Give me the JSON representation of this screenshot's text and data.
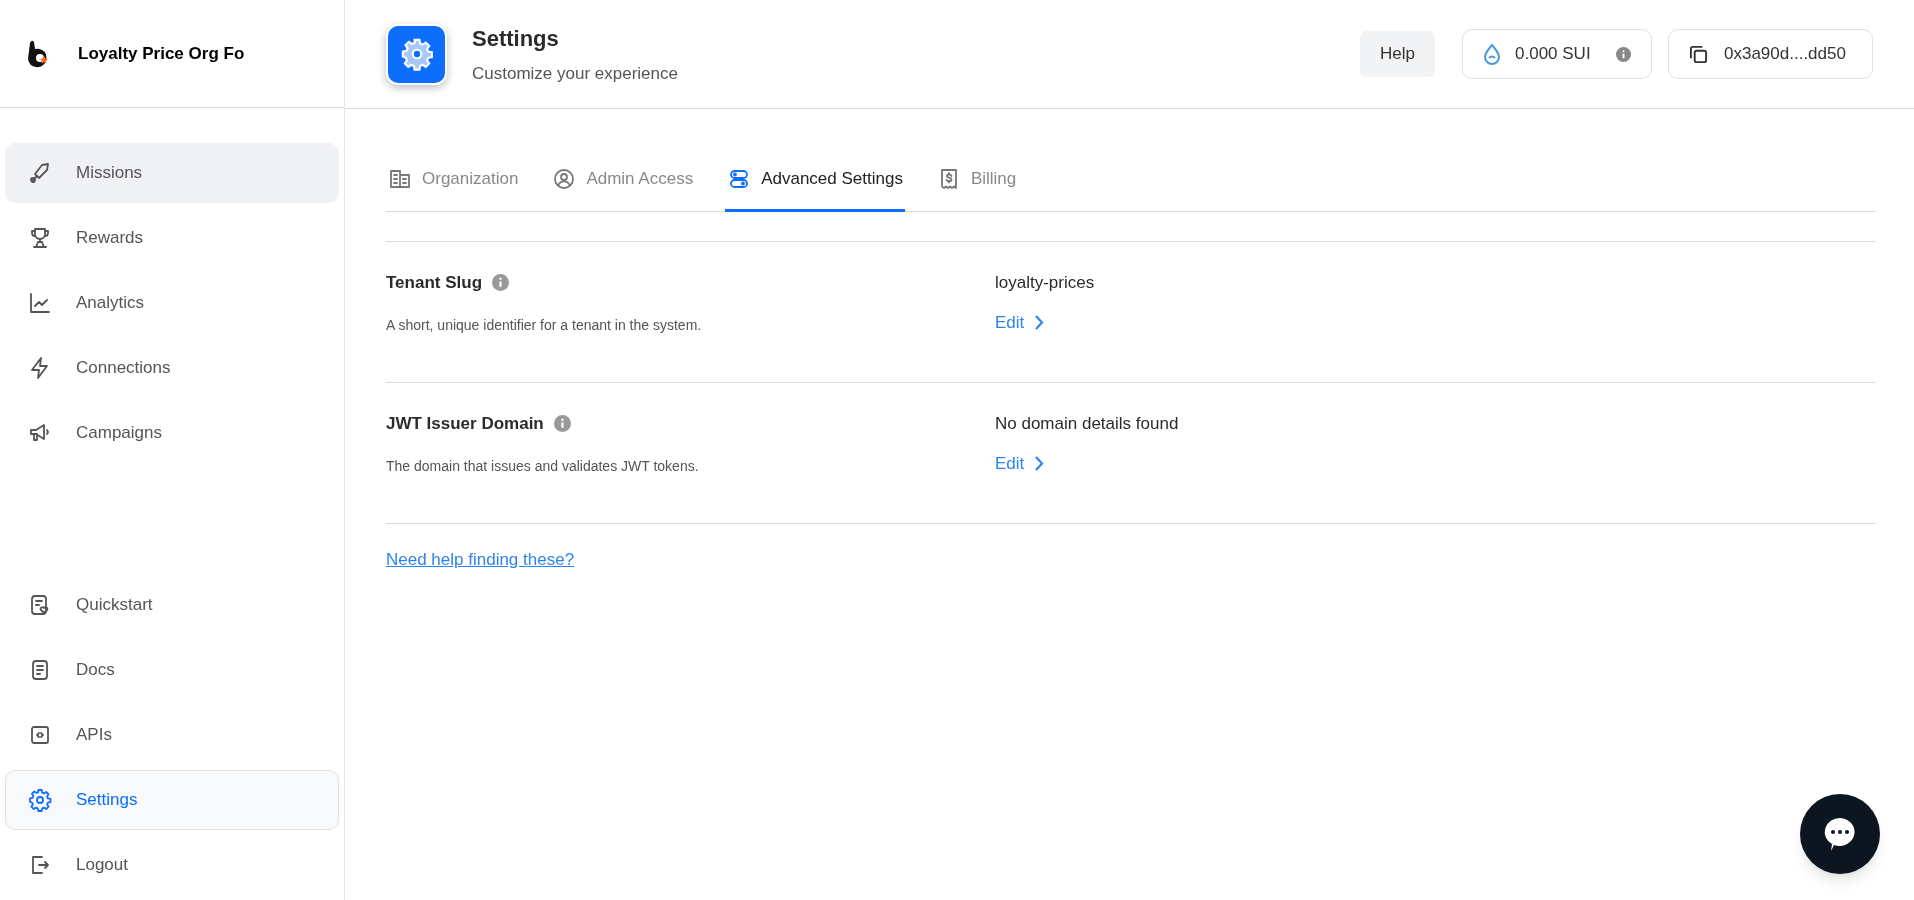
{
  "sidebar": {
    "org_name": "Loyalty Price Org Fo",
    "top_items": [
      {
        "label": "Missions",
        "selected": false,
        "highlighted": true
      },
      {
        "label": "Rewards",
        "selected": false,
        "highlighted": false
      },
      {
        "label": "Analytics",
        "selected": false,
        "highlighted": false
      },
      {
        "label": "Connections",
        "selected": false,
        "highlighted": false
      },
      {
        "label": "Campaigns",
        "selected": false,
        "highlighted": false
      }
    ],
    "bottom_items": [
      {
        "label": "Quickstart",
        "selected": false,
        "highlighted": false
      },
      {
        "label": "Docs",
        "selected": false,
        "highlighted": false
      },
      {
        "label": "APIs",
        "selected": false,
        "highlighted": false
      },
      {
        "label": "Settings",
        "selected": true,
        "highlighted": false
      },
      {
        "label": "Logout",
        "selected": false,
        "highlighted": false
      }
    ]
  },
  "header": {
    "title": "Settings",
    "subtitle": "Customize your experience",
    "help_button": "Help",
    "balance": "0.000 SUI",
    "wallet_address": "0x3a90d....dd50"
  },
  "tabs": [
    {
      "label": "Organization",
      "selected": false
    },
    {
      "label": "Admin Access",
      "selected": false
    },
    {
      "label": "Advanced Settings",
      "selected": true
    },
    {
      "label": "Billing",
      "selected": false
    }
  ],
  "settings": [
    {
      "title": "Tenant Slug",
      "description": "A short, unique identifier for a tenant in the system.",
      "value": "loyalty-prices",
      "action": "Edit"
    },
    {
      "title": "JWT Issuer Domain",
      "description": "The domain that issues and validates JWT tokens.",
      "value": "No domain details found",
      "action": "Edit"
    }
  ],
  "help_link": "Need help finding these?"
}
